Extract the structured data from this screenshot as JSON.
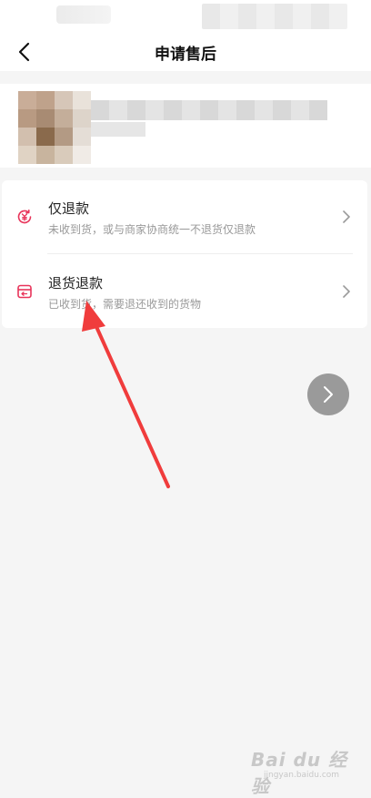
{
  "header": {
    "title": "申请售后"
  },
  "options": [
    {
      "title": "仅退款",
      "description": "未收到货，或与商家协商统一不退货仅退款",
      "icon": "refund-coin-icon"
    },
    {
      "title": "退货退款",
      "description": "已收到货，需要退还收到的货物",
      "icon": "return-box-icon"
    }
  ],
  "colors": {
    "accent": "#e8345a",
    "annotation": "#f03c3c",
    "background": "#f5f5f5"
  },
  "watermark": {
    "logo": "Bai du 经验",
    "url": "jingyan.baidu.com"
  }
}
